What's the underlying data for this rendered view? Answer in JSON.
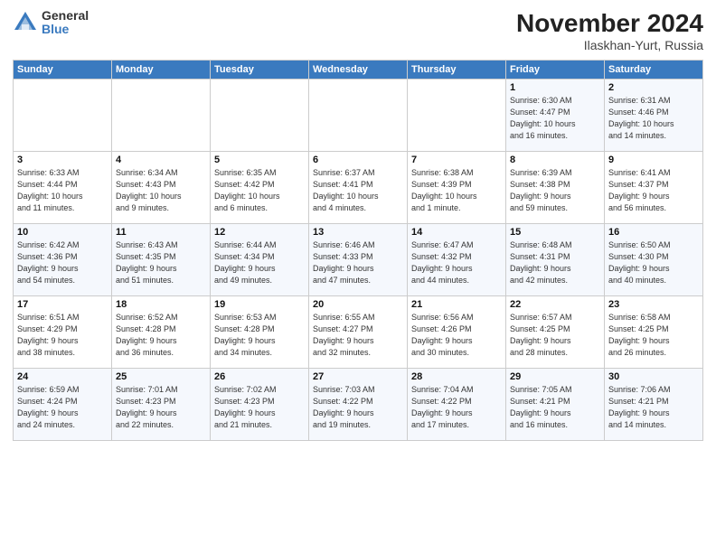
{
  "logo": {
    "general": "General",
    "blue": "Blue"
  },
  "title": "November 2024",
  "subtitle": "Ilaskhan-Yurt, Russia",
  "headers": [
    "Sunday",
    "Monday",
    "Tuesday",
    "Wednesday",
    "Thursday",
    "Friday",
    "Saturday"
  ],
  "weeks": [
    [
      {
        "day": "",
        "info": ""
      },
      {
        "day": "",
        "info": ""
      },
      {
        "day": "",
        "info": ""
      },
      {
        "day": "",
        "info": ""
      },
      {
        "day": "",
        "info": ""
      },
      {
        "day": "1",
        "info": "Sunrise: 6:30 AM\nSunset: 4:47 PM\nDaylight: 10 hours\nand 16 minutes."
      },
      {
        "day": "2",
        "info": "Sunrise: 6:31 AM\nSunset: 4:46 PM\nDaylight: 10 hours\nand 14 minutes."
      }
    ],
    [
      {
        "day": "3",
        "info": "Sunrise: 6:33 AM\nSunset: 4:44 PM\nDaylight: 10 hours\nand 11 minutes."
      },
      {
        "day": "4",
        "info": "Sunrise: 6:34 AM\nSunset: 4:43 PM\nDaylight: 10 hours\nand 9 minutes."
      },
      {
        "day": "5",
        "info": "Sunrise: 6:35 AM\nSunset: 4:42 PM\nDaylight: 10 hours\nand 6 minutes."
      },
      {
        "day": "6",
        "info": "Sunrise: 6:37 AM\nSunset: 4:41 PM\nDaylight: 10 hours\nand 4 minutes."
      },
      {
        "day": "7",
        "info": "Sunrise: 6:38 AM\nSunset: 4:39 PM\nDaylight: 10 hours\nand 1 minute."
      },
      {
        "day": "8",
        "info": "Sunrise: 6:39 AM\nSunset: 4:38 PM\nDaylight: 9 hours\nand 59 minutes."
      },
      {
        "day": "9",
        "info": "Sunrise: 6:41 AM\nSunset: 4:37 PM\nDaylight: 9 hours\nand 56 minutes."
      }
    ],
    [
      {
        "day": "10",
        "info": "Sunrise: 6:42 AM\nSunset: 4:36 PM\nDaylight: 9 hours\nand 54 minutes."
      },
      {
        "day": "11",
        "info": "Sunrise: 6:43 AM\nSunset: 4:35 PM\nDaylight: 9 hours\nand 51 minutes."
      },
      {
        "day": "12",
        "info": "Sunrise: 6:44 AM\nSunset: 4:34 PM\nDaylight: 9 hours\nand 49 minutes."
      },
      {
        "day": "13",
        "info": "Sunrise: 6:46 AM\nSunset: 4:33 PM\nDaylight: 9 hours\nand 47 minutes."
      },
      {
        "day": "14",
        "info": "Sunrise: 6:47 AM\nSunset: 4:32 PM\nDaylight: 9 hours\nand 44 minutes."
      },
      {
        "day": "15",
        "info": "Sunrise: 6:48 AM\nSunset: 4:31 PM\nDaylight: 9 hours\nand 42 minutes."
      },
      {
        "day": "16",
        "info": "Sunrise: 6:50 AM\nSunset: 4:30 PM\nDaylight: 9 hours\nand 40 minutes."
      }
    ],
    [
      {
        "day": "17",
        "info": "Sunrise: 6:51 AM\nSunset: 4:29 PM\nDaylight: 9 hours\nand 38 minutes."
      },
      {
        "day": "18",
        "info": "Sunrise: 6:52 AM\nSunset: 4:28 PM\nDaylight: 9 hours\nand 36 minutes."
      },
      {
        "day": "19",
        "info": "Sunrise: 6:53 AM\nSunset: 4:28 PM\nDaylight: 9 hours\nand 34 minutes."
      },
      {
        "day": "20",
        "info": "Sunrise: 6:55 AM\nSunset: 4:27 PM\nDaylight: 9 hours\nand 32 minutes."
      },
      {
        "day": "21",
        "info": "Sunrise: 6:56 AM\nSunset: 4:26 PM\nDaylight: 9 hours\nand 30 minutes."
      },
      {
        "day": "22",
        "info": "Sunrise: 6:57 AM\nSunset: 4:25 PM\nDaylight: 9 hours\nand 28 minutes."
      },
      {
        "day": "23",
        "info": "Sunrise: 6:58 AM\nSunset: 4:25 PM\nDaylight: 9 hours\nand 26 minutes."
      }
    ],
    [
      {
        "day": "24",
        "info": "Sunrise: 6:59 AM\nSunset: 4:24 PM\nDaylight: 9 hours\nand 24 minutes."
      },
      {
        "day": "25",
        "info": "Sunrise: 7:01 AM\nSunset: 4:23 PM\nDaylight: 9 hours\nand 22 minutes."
      },
      {
        "day": "26",
        "info": "Sunrise: 7:02 AM\nSunset: 4:23 PM\nDaylight: 9 hours\nand 21 minutes."
      },
      {
        "day": "27",
        "info": "Sunrise: 7:03 AM\nSunset: 4:22 PM\nDaylight: 9 hours\nand 19 minutes."
      },
      {
        "day": "28",
        "info": "Sunrise: 7:04 AM\nSunset: 4:22 PM\nDaylight: 9 hours\nand 17 minutes."
      },
      {
        "day": "29",
        "info": "Sunrise: 7:05 AM\nSunset: 4:21 PM\nDaylight: 9 hours\nand 16 minutes."
      },
      {
        "day": "30",
        "info": "Sunrise: 7:06 AM\nSunset: 4:21 PM\nDaylight: 9 hours\nand 14 minutes."
      }
    ]
  ]
}
